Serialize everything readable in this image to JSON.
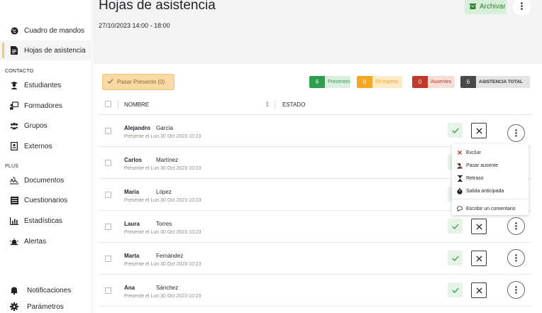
{
  "sidebar": {
    "items": [
      {
        "label": "Cuadro de mandos",
        "icon": "globe-icon"
      },
      {
        "label": "Hojas de asistencia",
        "icon": "document-icon"
      },
      {
        "label": "Estudiantes",
        "icon": "student-icon"
      },
      {
        "label": "Formadores",
        "icon": "teacher-board-icon"
      },
      {
        "label": "Grupos",
        "icon": "group-icon"
      },
      {
        "label": "Externos",
        "icon": "id-card-icon"
      },
      {
        "label": "Documentos",
        "icon": "signature-icon"
      },
      {
        "label": "Cuestionarios",
        "icon": "list-icon"
      },
      {
        "label": "Estadísticas",
        "icon": "chart-icon"
      },
      {
        "label": "Alertas",
        "icon": "alert-icon"
      }
    ],
    "sections": {
      "contact": "CONTACTO",
      "plus": "PLUS"
    },
    "bottom": [
      {
        "label": "Notificaciones",
        "icon": "bell-icon"
      },
      {
        "label": "Parámetros",
        "icon": "gear-icon"
      }
    ]
  },
  "header": {
    "title": "Hojas de asistencia",
    "date": "27/10/2023  14:00 - 18:00",
    "archive_label": "Archivar"
  },
  "toolbar": {
    "mark_present_label": "Pasar Presente (0)",
    "badges": [
      {
        "count": "6",
        "label": "Presentes",
        "color": "#2e9e4f",
        "bg": "#d8f0dd",
        "text_color": "#2e9e4f"
      },
      {
        "count": "0",
        "label": "En espera",
        "color": "#f5a623",
        "bg": "#fde9c4",
        "text_color": "#f5a623"
      },
      {
        "count": "0",
        "label": "Ausentes",
        "color": "#c0392b",
        "bg": "#f8dcd8",
        "text_color": "#c0392b"
      },
      {
        "count": "6",
        "label": "ASISTENCIA TOTAL",
        "color": "#4a4a4a",
        "bg": "#e3e3e3",
        "text_color": "#333333"
      }
    ]
  },
  "table": {
    "headers": {
      "name": "NOMBRE",
      "state": "ESTADO"
    },
    "rows": [
      {
        "first": "Alejandro",
        "last": "García",
        "sub": "Presente el Lun 30 Oct 2023 10:23"
      },
      {
        "first": "Carlos",
        "last": "Martínez",
        "sub": "Presente el Lun 30 Oct 2023 10:23"
      },
      {
        "first": "Maria",
        "last": "López",
        "sub": "Presente el Lun 30 Oct 2023 10:23"
      },
      {
        "first": "Laura",
        "last": "Torres",
        "sub": "Presente el Lun 30 Oct 2023 10:23"
      },
      {
        "first": "Marta",
        "last": "Fernández",
        "sub": "Presente el Lun 30 Oct 2023 10:23"
      },
      {
        "first": "Ana",
        "last": "Sánchez",
        "sub": "Presente el Lun 30 Oct 2023 10:23"
      }
    ]
  },
  "menu": {
    "items": [
      {
        "label": "Excluir",
        "icon": "close-icon"
      },
      {
        "label": "Pasar ausente",
        "icon": "user-absent-icon"
      },
      {
        "label": "Retraso",
        "icon": "hourglass-icon"
      },
      {
        "label": "Salida anticipada",
        "icon": "stopwatch-icon"
      },
      {
        "label": "Escribir un comentario",
        "icon": "comment-icon"
      }
    ]
  },
  "colors": {
    "accent": "#f7c873",
    "success": "#2e7d32",
    "danger": "#c0392b"
  }
}
